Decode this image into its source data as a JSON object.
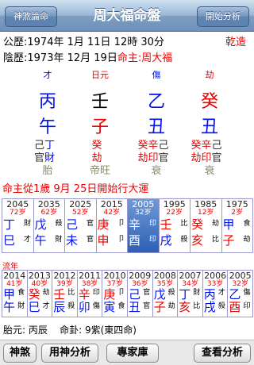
{
  "nav": {
    "left_button": "神煞論命",
    "title": "周大福命盤",
    "right_button": "開始分析"
  },
  "info": {
    "solar": "公歷:1974年 1月 11日 12時 30分",
    "gender": "乾造",
    "lunar_prefix": "陰歷:1973年 12月 19日",
    "master_label": "命主:",
    "master_name": "周大福"
  },
  "pillars": [
    {
      "god": "才",
      "god_color": "#0011ee",
      "stem": "丙",
      "stem_color": "#0011ee",
      "branch": "午",
      "branch_color": "#0011ee",
      "hidden": [
        {
          "c": "己",
          "color": "#333"
        },
        {
          "c": "丁",
          "color": "#0011ee"
        }
      ],
      "hidden_gods": [
        {
          "c": "官",
          "color": "#333"
        },
        {
          "c": "財",
          "color": "#0011ee"
        }
      ],
      "phase": "胎"
    },
    {
      "god": "日元",
      "god_color": "#ee0000",
      "stem": "壬",
      "stem_color": "#000000",
      "branch": "子",
      "branch_color": "#ee0000",
      "hidden": [
        {
          "c": "癸",
          "color": "#ee0000"
        }
      ],
      "hidden_gods": [
        {
          "c": "劫",
          "color": "#ee0000"
        }
      ],
      "phase": "帝旺"
    },
    {
      "god": "傷",
      "god_color": "#0011ee",
      "stem": "乙",
      "stem_color": "#0011ee",
      "branch": "丑",
      "branch_color": "#0011ee",
      "hidden": [
        {
          "c": "癸",
          "color": "#ee0000"
        },
        {
          "c": "辛",
          "color": "#ee0000"
        },
        {
          "c": "己",
          "color": "#333"
        }
      ],
      "hidden_gods": [
        {
          "c": "劫",
          "color": "#ee0000"
        },
        {
          "c": "印",
          "color": "#ee0000"
        },
        {
          "c": "官",
          "color": "#333"
        }
      ],
      "phase": "衰"
    },
    {
      "god": "劫",
      "god_color": "#ee0000",
      "stem": "癸",
      "stem_color": "#ee0000",
      "branch": "丑",
      "branch_color": "#0011ee",
      "hidden": [
        {
          "c": "癸",
          "color": "#ee0000"
        },
        {
          "c": "辛",
          "color": "#ee0000"
        },
        {
          "c": "己",
          "color": "#333"
        }
      ],
      "hidden_gods": [
        {
          "c": "劫",
          "color": "#ee0000"
        },
        {
          "c": "印",
          "color": "#ee0000"
        },
        {
          "c": "官",
          "color": "#333"
        }
      ],
      "phase": "衰"
    }
  ],
  "luck_header": "命主從1歲 9月 25日開始行大運",
  "dayun": [
    {
      "year": "2045",
      "age": "72岁",
      "stem": "丁",
      "stem_color": "#0011ee",
      "sg": "財",
      "branch": "巳",
      "branch_color": "#0011ee",
      "bg": "才",
      "selected": false
    },
    {
      "year": "2035",
      "age": "62岁",
      "stem": "戊",
      "stem_color": "#0011ee",
      "sg": "殺",
      "branch": "午",
      "branch_color": "#0011ee",
      "bg": "財",
      "selected": false
    },
    {
      "year": "2025",
      "age": "52岁",
      "stem": "己",
      "stem_color": "#0011ee",
      "sg": "官",
      "branch": "未",
      "branch_color": "#0011ee",
      "bg": "官",
      "selected": false
    },
    {
      "year": "2015",
      "age": "42岁",
      "stem": "庚",
      "stem_color": "#ee0000",
      "sg": "卩",
      "branch": "申",
      "branch_color": "#ee0000",
      "bg": "卩",
      "selected": false
    },
    {
      "year": "2005",
      "age": "32岁",
      "stem": "辛",
      "stem_color": "#ffffff",
      "sg": "印",
      "branch": "酉",
      "branch_color": "#ffffff",
      "bg": "印",
      "selected": true
    },
    {
      "year": "1995",
      "age": "22岁",
      "stem": "壬",
      "stem_color": "#ee0000",
      "sg": "比",
      "branch": "戌",
      "branch_color": "#0011ee",
      "bg": "殺",
      "selected": false
    },
    {
      "year": "1985",
      "age": "12岁",
      "stem": "癸",
      "stem_color": "#ee0000",
      "sg": "劫",
      "branch": "亥",
      "branch_color": "#ee0000",
      "bg": "比",
      "selected": false
    },
    {
      "year": "1975",
      "age": "2岁",
      "stem": "甲",
      "stem_color": "#0011ee",
      "sg": "食",
      "branch": "子",
      "branch_color": "#ee0000",
      "bg": "劫",
      "selected": false
    }
  ],
  "liunian_label": "流年",
  "liunian": [
    {
      "year": "2014",
      "age": "41岁",
      "stem": "甲",
      "stem_color": "#0011ee",
      "sg": "食",
      "branch": "午",
      "branch_color": "#0011ee",
      "bg": "財"
    },
    {
      "year": "2013",
      "age": "40岁",
      "stem": "癸",
      "stem_color": "#ee0000",
      "sg": "劫",
      "branch": "巳",
      "branch_color": "#0011ee",
      "bg": "才"
    },
    {
      "year": "2012",
      "age": "39岁",
      "stem": "壬",
      "stem_color": "#ee0000",
      "sg": "比",
      "branch": "辰",
      "branch_color": "#0011ee",
      "bg": "殺"
    },
    {
      "year": "2011",
      "age": "38岁",
      "stem": "辛",
      "stem_color": "#ee0000",
      "sg": "印",
      "branch": "卯",
      "branch_color": "#0011ee",
      "bg": "傷"
    },
    {
      "year": "2010",
      "age": "37岁",
      "stem": "庚",
      "stem_color": "#ee0000",
      "sg": "卩",
      "branch": "寅",
      "branch_color": "#0011ee",
      "bg": "食"
    },
    {
      "year": "2009",
      "age": "36岁",
      "stem": "己",
      "stem_color": "#0011ee",
      "sg": "官",
      "branch": "丑",
      "branch_color": "#0011ee",
      "bg": "官"
    },
    {
      "year": "2008",
      "age": "35岁",
      "stem": "戊",
      "stem_color": "#0011ee",
      "sg": "殺",
      "branch": "子",
      "branch_color": "#ee0000",
      "bg": "劫"
    },
    {
      "year": "2007",
      "age": "34岁",
      "stem": "丁",
      "stem_color": "#0011ee",
      "sg": "財",
      "branch": "亥",
      "branch_color": "#ee0000",
      "bg": "比"
    },
    {
      "year": "2006",
      "age": "33岁",
      "stem": "丙",
      "stem_color": "#0011ee",
      "sg": "才",
      "branch": "戌",
      "branch_color": "#0011ee",
      "bg": "殺"
    },
    {
      "year": "2005",
      "age": "32岁",
      "stem": "乙",
      "stem_color": "#0011ee",
      "sg": "傷",
      "branch": "酉",
      "branch_color": "#ee0000",
      "bg": "印"
    }
  ],
  "footer": {
    "taiyuan": "胎元: 丙辰",
    "minggua": "命卦: 9紫(東四命)"
  },
  "buttons": {
    "b1": "神煞",
    "b2": "用神分析",
    "b3": "專家庫",
    "b4": "查看分析"
  }
}
